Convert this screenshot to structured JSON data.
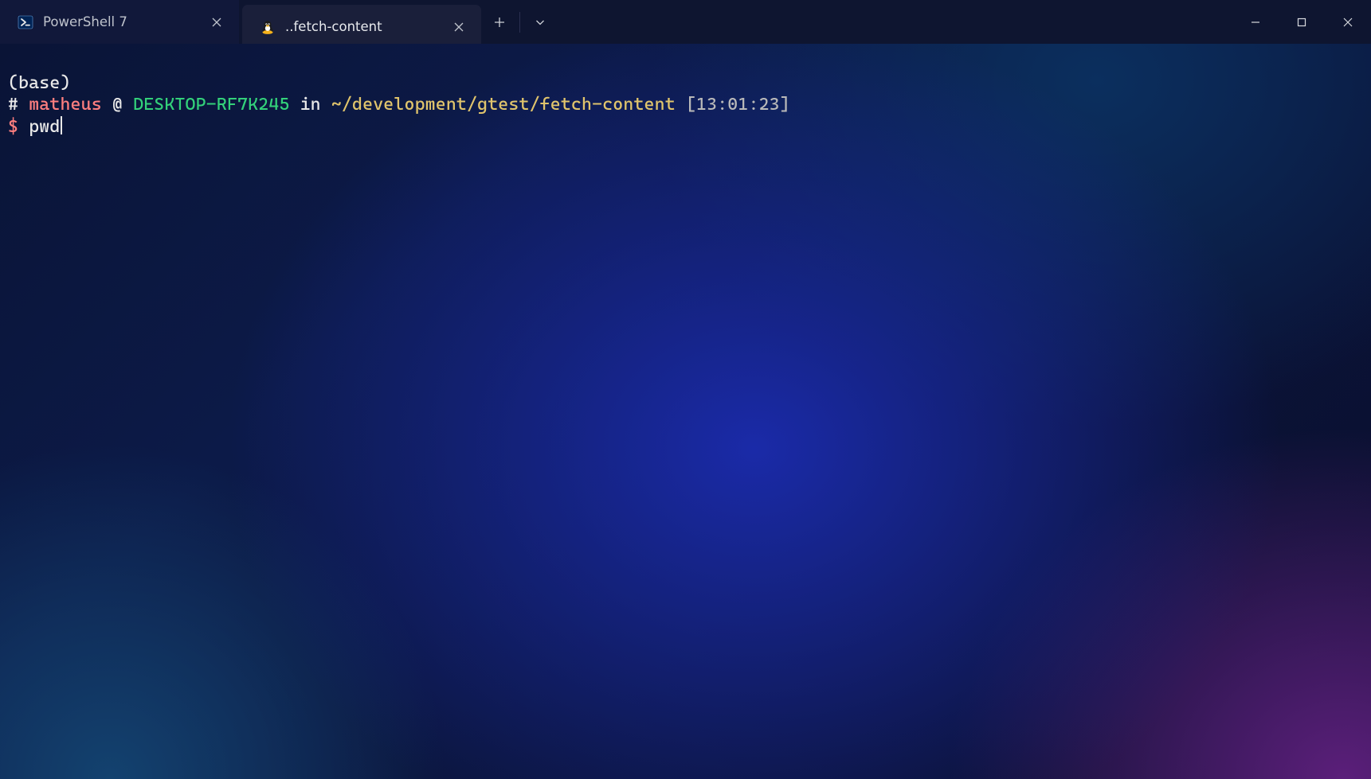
{
  "tabs": {
    "inactive": {
      "title": "PowerShell 7"
    },
    "active": {
      "title": "..fetch-content"
    }
  },
  "terminal": {
    "env_line": "(base)",
    "hash": "#",
    "user": "matheus",
    "at": "@",
    "host": "DESKTOP-RF7K245",
    "in_word": "in",
    "path": "~/development/gtest/fetch-content",
    "time": "[13:01:23]",
    "prompt": "$",
    "command": "pwd"
  }
}
